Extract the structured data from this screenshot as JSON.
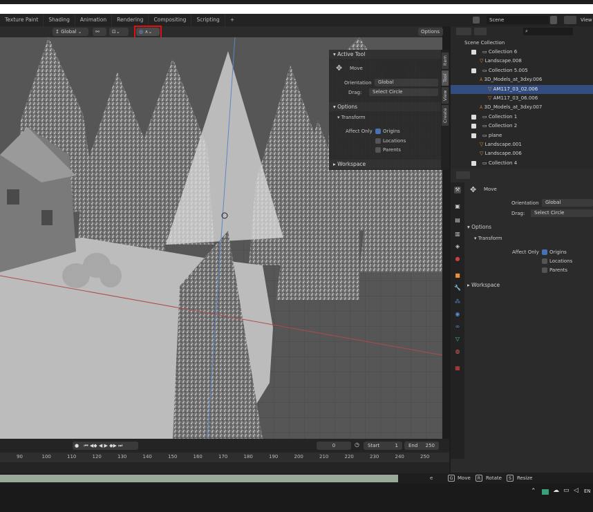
{
  "workspace_tabs": [
    "Texture Paint",
    "Shading",
    "Animation",
    "Rendering",
    "Compositing",
    "Scripting",
    "+"
  ],
  "scene": {
    "name": "Scene",
    "view_label": "View"
  },
  "viewport_header": {
    "orientation": "Global",
    "options_label": "Options"
  },
  "npanel": {
    "active_tool_title": "Active Tool",
    "tool_name": "Move",
    "orientation_label": "Orientation",
    "orientation_value": "Global",
    "drag_label": "Drag:",
    "drag_value": "Select Circle",
    "options_title": "Options",
    "transform_title": "Transform",
    "affect_only_label": "Affect Only",
    "origins_label": "Origins",
    "locations_label": "Locations",
    "parents_label": "Parents",
    "workspace_title": "Workspace",
    "side_tabs": [
      "Item",
      "Tool",
      "View",
      "Create"
    ]
  },
  "outliner": {
    "scene_collection": "Scene Collection",
    "rows": [
      {
        "label": "Collection 6",
        "indent": 0
      },
      {
        "label": "Landscape.008",
        "indent": 1
      },
      {
        "label": "Collection 5.005",
        "indent": 0
      },
      {
        "label": "3D_Models_at_3dxy.006",
        "indent": 1
      },
      {
        "label": "AM117_03_02.006",
        "indent": 2
      },
      {
        "label": "AM117_03_06.006",
        "indent": 2
      },
      {
        "label": "3D_Models_at_3dxy.007",
        "indent": 1
      },
      {
        "label": "Collection 1",
        "indent": 0
      },
      {
        "label": "Collection 2",
        "indent": 0
      },
      {
        "label": "plane",
        "indent": 0
      },
      {
        "label": "Landscape.001",
        "indent": 1
      },
      {
        "label": "Landscape.006",
        "indent": 1
      },
      {
        "label": "Collection 4",
        "indent": 0
      }
    ],
    "selected_index": 4
  },
  "properties": {
    "tool_name": "Move",
    "orientation_label": "Orientation",
    "orientation_value": "Global",
    "drag_label": "Drag:",
    "drag_value": "Select Circle",
    "options_title": "Options",
    "transform_title": "Transform",
    "affect_only_label": "Affect Only",
    "origins_label": "Origins",
    "locations_label": "Locations",
    "parents_label": "Parents",
    "workspace_title": "Workspace"
  },
  "timeline": {
    "current_frame": "0",
    "start_label": "Start",
    "start_value": "1",
    "end_label": "End",
    "end_value": "250",
    "ruler": [
      "90",
      "100",
      "110",
      "120",
      "130",
      "140",
      "150",
      "160",
      "170",
      "180",
      "190",
      "200",
      "210",
      "220",
      "230",
      "240",
      "250"
    ]
  },
  "statusbar": {
    "move_key": "G",
    "move_label": "Move",
    "rotate_key": "R",
    "rotate_label": "Rotate",
    "resize_key": "S",
    "resize_label": "Resize",
    "partial": "e"
  },
  "taskbar": {
    "lang": "EN"
  },
  "colors": {
    "selection": "#334d80",
    "accent": "#4772b3",
    "highlight_box": "#e01010"
  }
}
